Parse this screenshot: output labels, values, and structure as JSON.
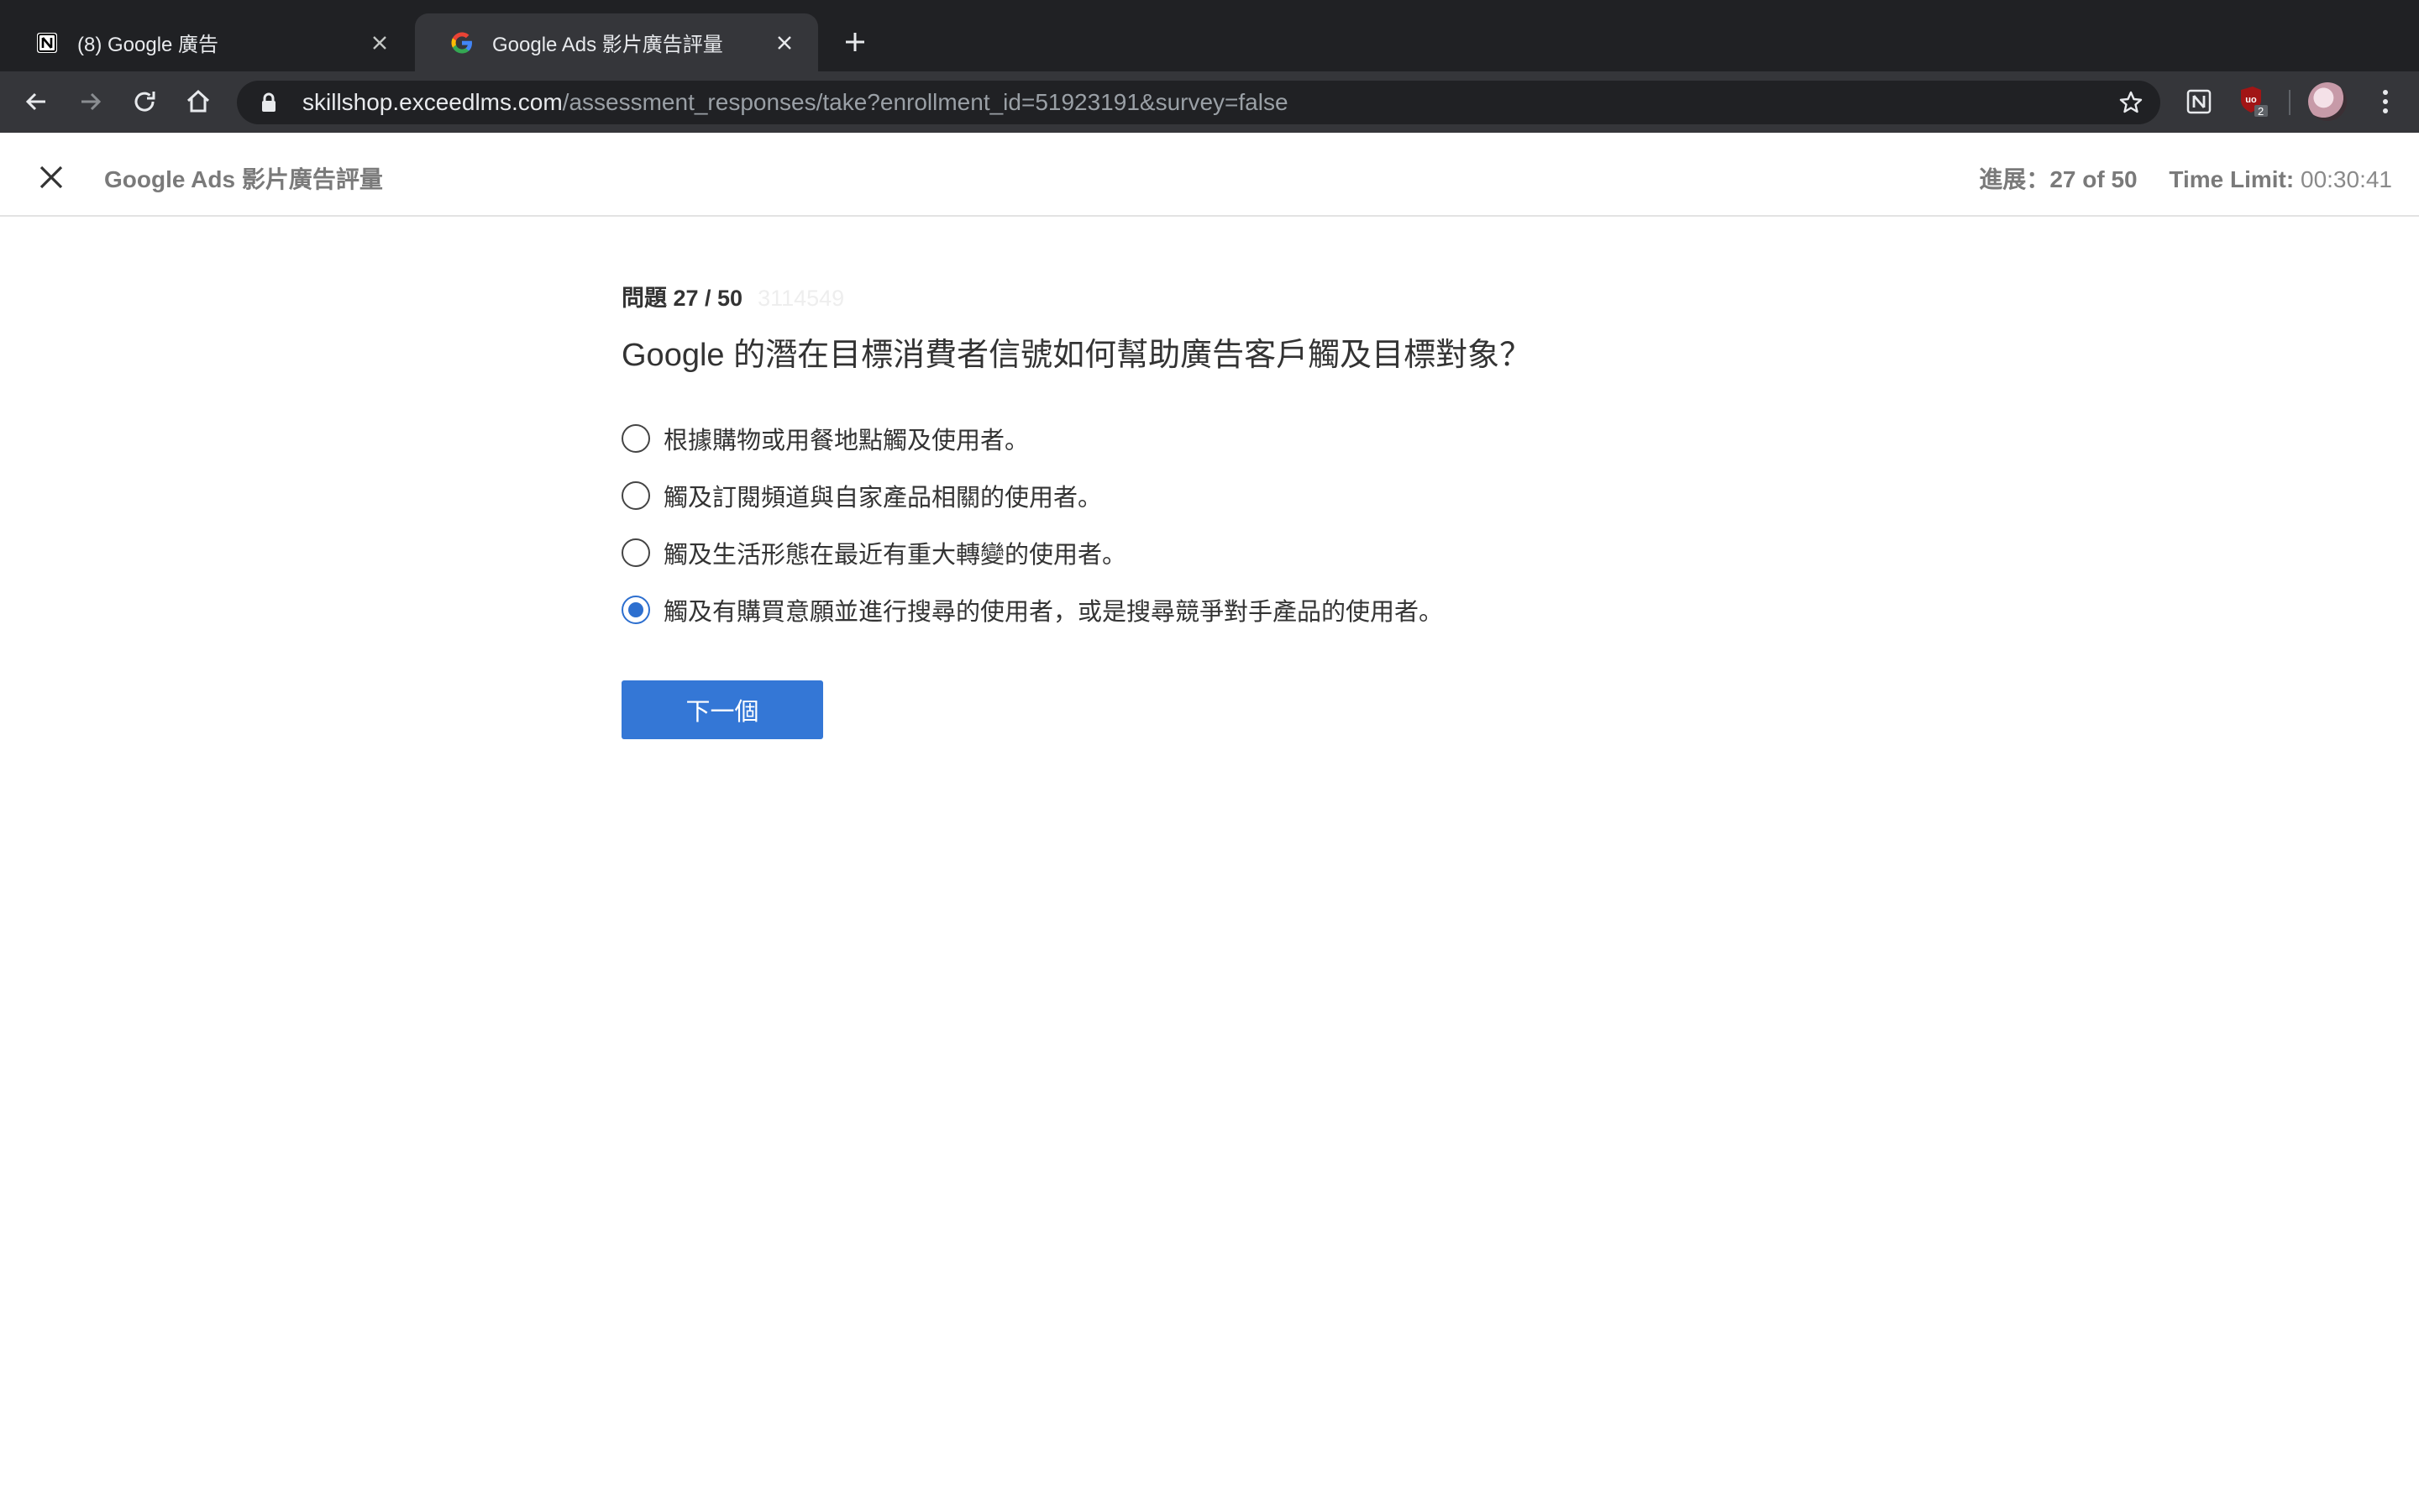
{
  "browser": {
    "tabs": [
      {
        "title": "(8) Google 廣告",
        "active": false,
        "favicon": "notion-icon"
      },
      {
        "title": "Google Ads 影片廣告評量",
        "active": true,
        "favicon": "google-icon"
      }
    ],
    "url_host": "skillshop.exceedlms.com",
    "url_path": "/assessment_responses/take?enrollment_id=51923191&survey=false",
    "extension_badge": "2"
  },
  "header": {
    "course_title": "Google Ads 影片廣告評量",
    "progress_label": "進展：",
    "progress_value": "27 of 50",
    "time_limit_label": "Time Limit:",
    "time_limit_value": "00:30:41"
  },
  "question": {
    "counter": "問題 27 / 50",
    "id": "3114549",
    "text": "Google 的潛在目標消費者信號如何幫助廣告客戶觸及目標對象？",
    "options": [
      {
        "label": "根據購物或用餐地點觸及使用者。",
        "selected": false
      },
      {
        "label": "觸及訂閱頻道與自家產品相關的使用者。",
        "selected": false
      },
      {
        "label": "觸及生活形態在最近有重大轉變的使用者。",
        "selected": false
      },
      {
        "label": "觸及有購買意願並進行搜尋的使用者，或是搜尋競爭對手產品的使用者。",
        "selected": true
      }
    ],
    "next_label": "下一個"
  },
  "colors": {
    "accent": "#3477d6",
    "tabbar": "#202124",
    "toolbar": "#35363a"
  }
}
